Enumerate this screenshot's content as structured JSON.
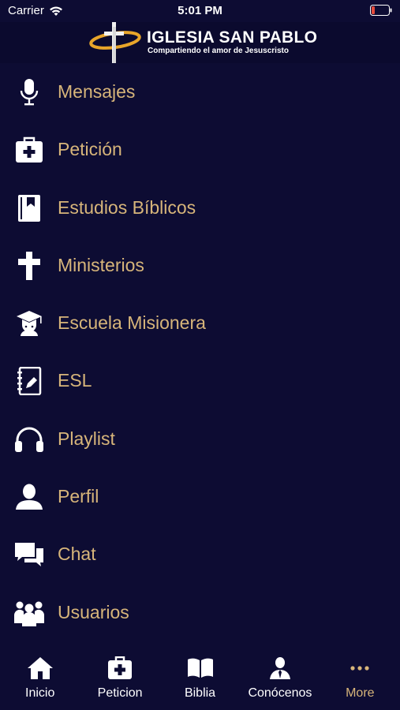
{
  "status_bar": {
    "carrier": "Carrier",
    "time": "5:01 PM",
    "battery_color": "#e74c3c"
  },
  "header": {
    "title": "IGLESIA SAN PABLO",
    "subtitle": "Compartiendo el amor de Jesuscristo",
    "accent": "#e8a52a"
  },
  "menu": {
    "label_color": "#d7b57a",
    "items": [
      {
        "label": "Mensajes",
        "icon": "microphone-icon"
      },
      {
        "label": "Petición",
        "icon": "medkit-icon"
      },
      {
        "label": "Estudios Bíblicos",
        "icon": "book-bookmark-icon"
      },
      {
        "label": "Ministerios",
        "icon": "cross-icon"
      },
      {
        "label": "Escuela Misionera",
        "icon": "graduate-icon"
      },
      {
        "label": "ESL",
        "icon": "notebook-pen-icon"
      },
      {
        "label": "Playlist",
        "icon": "headphones-icon"
      },
      {
        "label": "Perfil",
        "icon": "user-icon"
      },
      {
        "label": "Chat",
        "icon": "chat-bubbles-icon"
      },
      {
        "label": "Usuarios",
        "icon": "users-group-icon"
      }
    ]
  },
  "tab_bar": {
    "tabs": [
      {
        "label": "Inicio",
        "icon": "home-icon",
        "active": false
      },
      {
        "label": "Peticion",
        "icon": "medkit-icon",
        "active": false
      },
      {
        "label": "Biblia",
        "icon": "open-book-icon",
        "active": false
      },
      {
        "label": "Conócenos",
        "icon": "person-tie-icon",
        "active": false
      },
      {
        "label": "More",
        "icon": "more-dots-icon",
        "active": true
      }
    ]
  }
}
